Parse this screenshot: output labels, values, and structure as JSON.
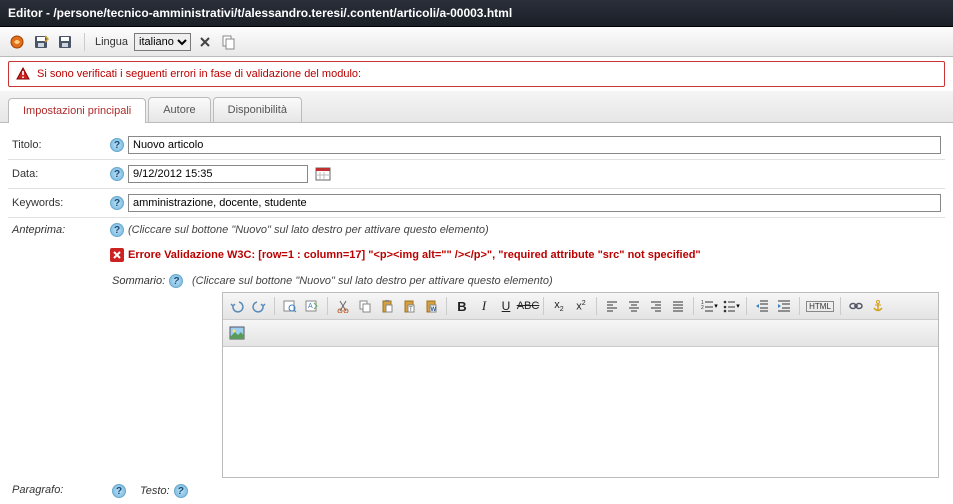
{
  "window": {
    "title": "Editor - /persone/tecnico-amministrativi/t/alessandro.teresi/.content/articoli/a-00003.html"
  },
  "toolbar": {
    "lingua_label": "Lingua",
    "lingua_value": "italiano"
  },
  "error_banner": {
    "message": "Si sono verificati i seguenti errori in fase di validazione del modulo:"
  },
  "tabs": [
    {
      "label": "Impostazioni principali",
      "active": true
    },
    {
      "label": "Autore",
      "active": false
    },
    {
      "label": "Disponibilità",
      "active": false
    }
  ],
  "form": {
    "titolo_label": "Titolo:",
    "titolo_value": "Nuovo articolo",
    "data_label": "Data:",
    "data_value": "9/12/2012 15:35",
    "keywords_label": "Keywords:",
    "keywords_value": "amministrazione, docente, studente",
    "anteprima_label": "Anteprima:",
    "anteprima_hint": "(Cliccare sul bottone \"Nuovo\" sul lato destro per attivare questo elemento)",
    "validation_error": "Errore Validazione W3C: [row=1 : column=17] \"<p><img alt=\"\" /></p>\", \"required attribute \"src\" not specified\"",
    "sommario_label": "Sommario:",
    "sommario_hint": "(Cliccare sul bottone \"Nuovo\" sul lato destro per attivare questo elemento)",
    "paragrafo_label": "Paragrafo:",
    "testo_label": "Testo:"
  },
  "editor_buttons": {
    "html_label": "HTML"
  }
}
